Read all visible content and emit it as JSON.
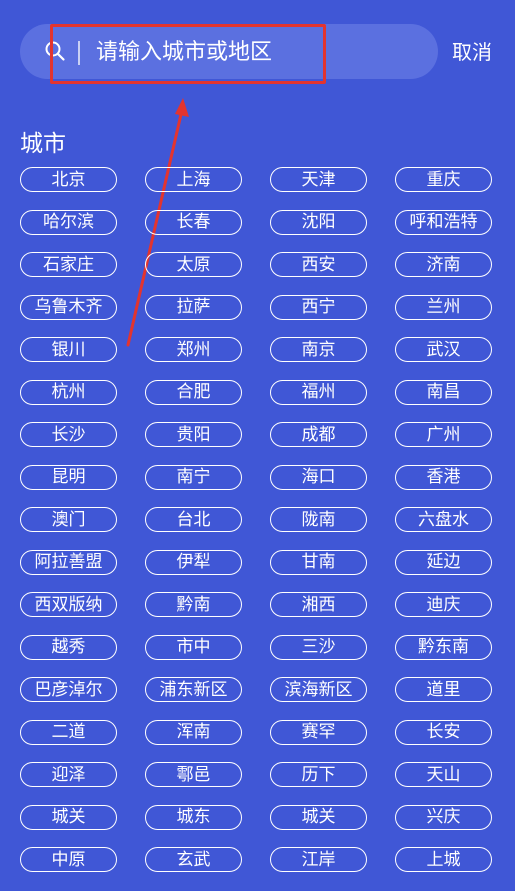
{
  "search": {
    "placeholder": "请输入城市或地区",
    "cancel_label": "取消"
  },
  "section": {
    "title": "城市"
  },
  "cities": [
    "北京",
    "上海",
    "天津",
    "重庆",
    "哈尔滨",
    "长春",
    "沈阳",
    "呼和浩特",
    "石家庄",
    "太原",
    "西安",
    "济南",
    "乌鲁木齐",
    "拉萨",
    "西宁",
    "兰州",
    "银川",
    "郑州",
    "南京",
    "武汉",
    "杭州",
    "合肥",
    "福州",
    "南昌",
    "长沙",
    "贵阳",
    "成都",
    "广州",
    "昆明",
    "南宁",
    "海口",
    "香港",
    "澳门",
    "台北",
    "陇南",
    "六盘水",
    "阿拉善盟",
    "伊犁",
    "甘南",
    "延边",
    "西双版纳",
    "黔南",
    "湘西",
    "迪庆",
    "越秀",
    "市中",
    "三沙",
    "黔东南",
    "巴彦淖尔",
    "浦东新区",
    "滨海新区",
    "道里",
    "二道",
    "浑南",
    "赛罕",
    "长安",
    "迎泽",
    "鄠邑",
    "历下",
    "天山",
    "城关",
    "城东",
    "城关",
    "兴庆",
    "中原",
    "玄武",
    "江岸",
    "上城"
  ],
  "colors": {
    "background": "#4057d6",
    "search_bar": "#5b70e0",
    "highlight": "#e3342f",
    "text": "#ffffff"
  },
  "icons": {
    "search": "search-icon"
  }
}
